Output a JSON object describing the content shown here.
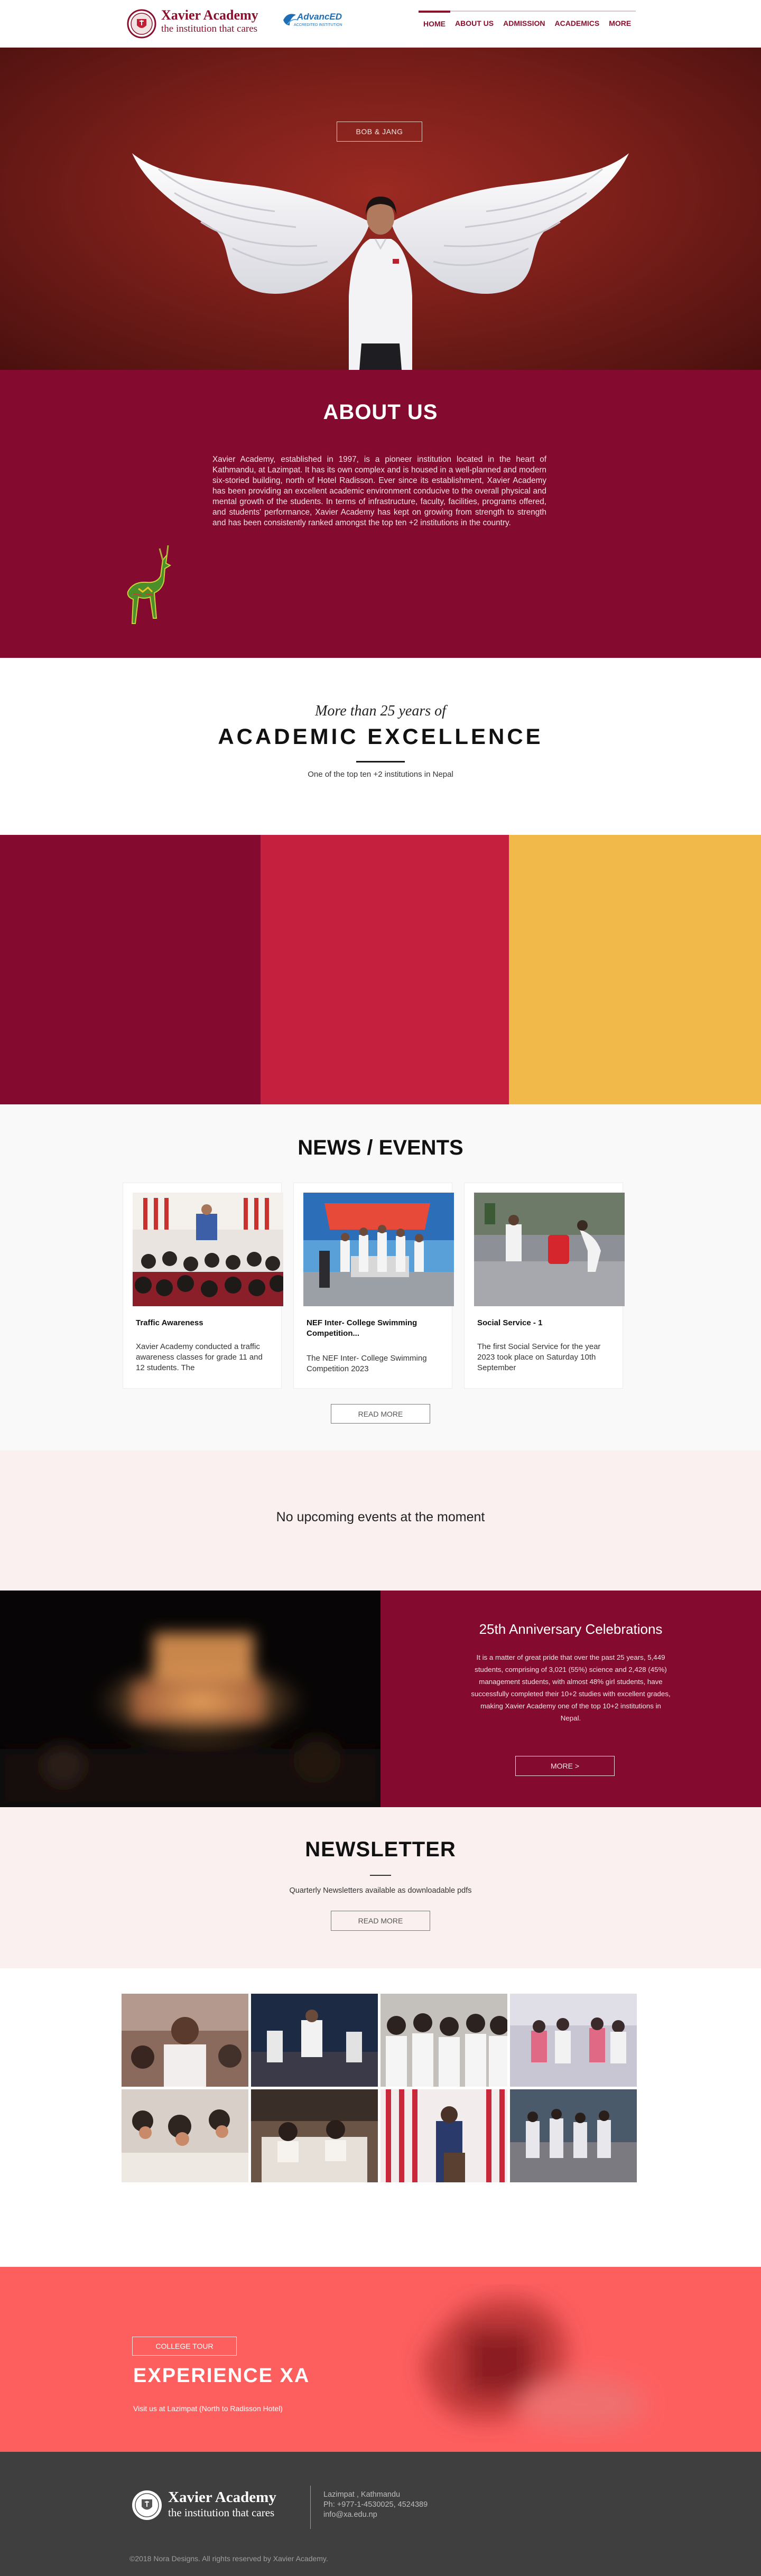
{
  "header": {
    "logo_name": "Xavier Academy",
    "logo_tagline": "the institution that cares",
    "partner_badge": "AdvancED",
    "partner_badge_sub": "ACCREDITED INSTITUTION",
    "nav": [
      {
        "label": "HOME",
        "active": true
      },
      {
        "label": "ABOUT US",
        "active": false
      },
      {
        "label": "ADMISSION",
        "active": false
      },
      {
        "label": "ACADEMICS",
        "active": false
      },
      {
        "label": "MORE",
        "active": false
      }
    ]
  },
  "hero": {
    "button_label": "BOB & JANG"
  },
  "about": {
    "title": "ABOUT US",
    "text": "Xavier Academy, established in 1997, is a pioneer institution located in the heart of Kathmandu, at Lazimpat. It has its own complex and is housed in a well-planned and modern six-storied building, north of Hotel Radisson. Ever since its establishment, Xavier Academy has been providing an excellent academic environment conducive to the overall physical and mental growth of the students. In terms of infrastructure, faculty, facilities, programs offered, and students' performance, Xavier Academy has kept on growing from strength to strength and has been consistently ranked amongst the top ten +2 institutions in the country."
  },
  "excellence": {
    "pre_title": "More than 25 years of",
    "title": "ACADEMIC EXCELLENCE",
    "subtitle": "One of the top ten +2 institutions in Nepal"
  },
  "colors": {
    "maroon": "#850a2f",
    "crimson": "#c5213f",
    "gold": "#f0b94a",
    "coral": "#fd5f5f",
    "footer": "#3f3f3f"
  },
  "news": {
    "title": "NEWS / EVENTS",
    "cards": [
      {
        "title": "Traffic Awareness",
        "body": "Xavier Academy conducted a traffic awareness classes for grade 11 and 12 students. The"
      },
      {
        "title": "NEF Inter- College Swimming Competition...",
        "body": "The NEF Inter- College Swimming Competition 2023"
      },
      {
        "title": "Social Service - 1",
        "body": "The first Social Service for the year 2023 took place on Saturday 10th September"
      }
    ],
    "read_more": "READ MORE"
  },
  "events": {
    "empty_text": "No upcoming events at the moment"
  },
  "anniversary": {
    "title": "25th Anniversary Celebrations",
    "text": "It is a matter of great pride that over the past 25 years, 5,449 students, comprising of 3,021 (55%) science and 2,428 (45%) management students, with almost 48% girl students, have successfully completed their 10+2 studies with excellent grades, making Xavier Academy one of the top 10+2 institutions in Nepal.",
    "more_label": "MORE >"
  },
  "newsletter": {
    "title": "NEWSLETTER",
    "subtitle": "Quarterly Newsletters available as downloadable pdfs",
    "button_label": "READ MORE"
  },
  "experience": {
    "tag": "COLLEGE TOUR",
    "title": "EXPERIENCE XA",
    "subtitle": "Visit us at Lazimpat (North to Radisson Hotel)"
  },
  "footer": {
    "name": "Xavier Academy",
    "tagline": "the institution that cares",
    "address": "Lazimpat , Kathmandu",
    "phone": "Ph: +977-1-4530025, 4524389",
    "email": "info@xa.edu.np",
    "copyright": "©2018 Nora Designs. All rights reserved by Xavier Academy."
  }
}
